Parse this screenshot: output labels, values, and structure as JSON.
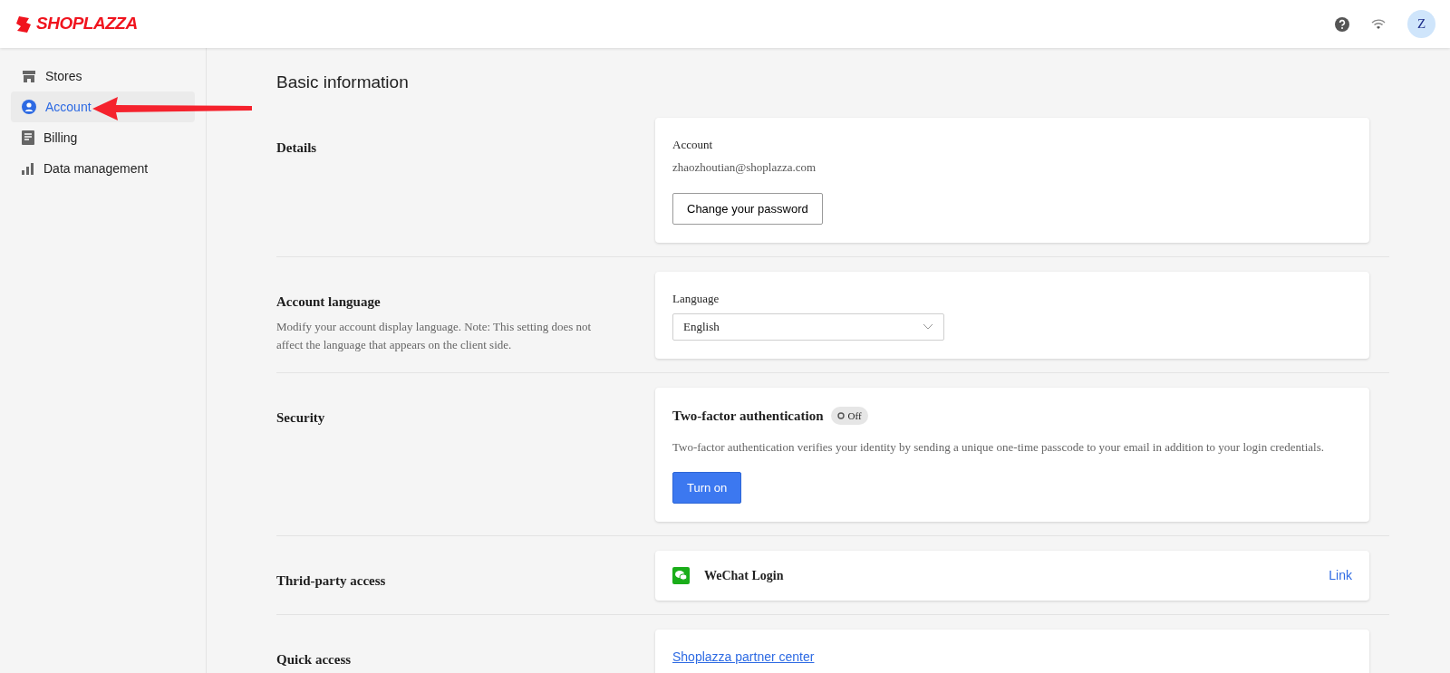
{
  "header": {
    "logo": "SHOPLAZZA",
    "avatar": "Z"
  },
  "sidebar": {
    "items": [
      {
        "label": "Stores",
        "kind": "store",
        "selected": false
      },
      {
        "label": "Account",
        "kind": "user",
        "selected": true
      },
      {
        "label": "Billing",
        "kind": "document",
        "selected": false
      },
      {
        "label": "Data management",
        "kind": "chart",
        "selected": false
      }
    ]
  },
  "page_title": "Basic information",
  "sections": [
    {
      "kind": "details",
      "title": "Details",
      "field_label": "Account",
      "field_value": "zhaozhoutian@shoplazza.com",
      "button": "Change your password"
    },
    {
      "kind": "language",
      "title": "Account language",
      "description": "Modify your account display language. Note: This setting does not affect the language that appears on the client side.",
      "field_label": "Language",
      "value": "English"
    },
    {
      "kind": "security",
      "title": "Security",
      "card_title": "Two-factor authentication",
      "status": "Off",
      "on": false,
      "description": "Two-factor authentication verifies your identity by sending a unique one-time passcode to your email in addition to your login credentials.",
      "button": "Turn on"
    },
    {
      "kind": "third_party",
      "title": "Thrid-party access",
      "service": "WeChat Login",
      "action": "Link"
    },
    {
      "kind": "quick_access",
      "title": "Quick access",
      "link": "Shoplazza partner center"
    }
  ]
}
